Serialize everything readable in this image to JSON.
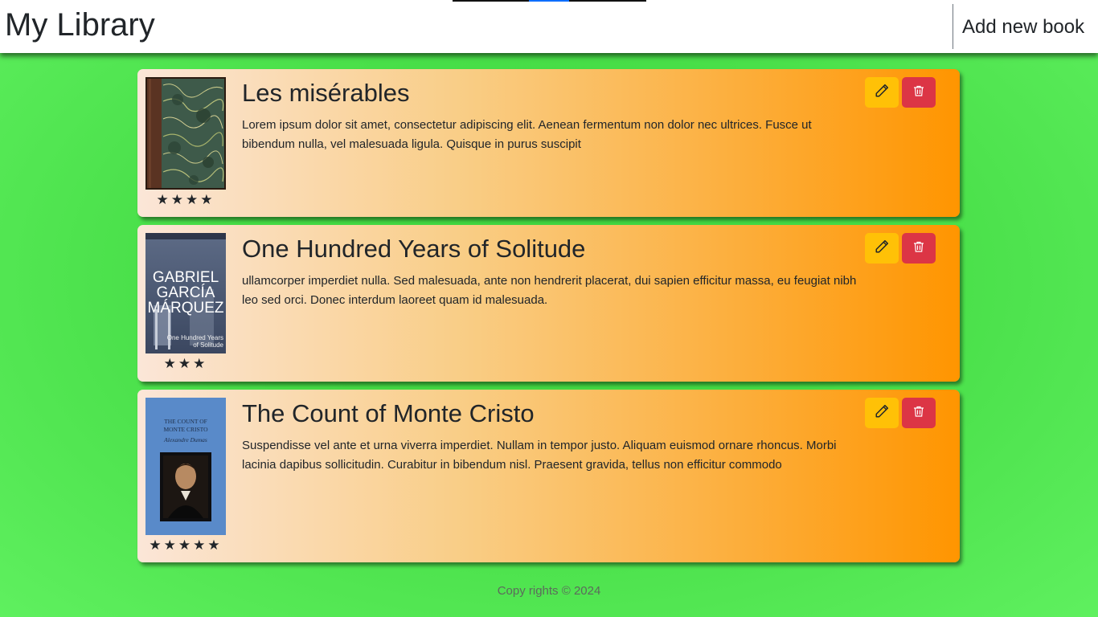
{
  "navbar": {
    "brand": "My Library",
    "add_label": "Add new book"
  },
  "books": [
    {
      "title": "Les misérables",
      "description": "Lorem ipsum dolor sit amet, consectetur adipiscing elit. Aenean fermentum non dolor nec ultrices. Fusce ut bibendum nulla, vel malesuada ligula. Quisque in purus suscipit",
      "rating": 4,
      "stars": "★★★★",
      "cover": "marbled-antique-book-cover"
    },
    {
      "title": "One Hundred Years of Solitude",
      "description": "ullamcorper imperdiet nulla. Sed malesuada, ante non hendrerit placerat, dui sapien efficitur massa, eu feugiat nibh leo sed orci. Donec interdum laoreet quam id malesuada.",
      "rating": 3,
      "stars": "★★★",
      "cover": {
        "author_line1": "GABRIEL",
        "author_line2": "GARCÍA",
        "author_line3": "MÁRQUEZ",
        "subtitle_line1": "One Hundred Years",
        "subtitle_line2": "of Solitude"
      }
    },
    {
      "title": "The Count of Monte Cristo",
      "description": "Suspendisse vel ante et urna viverra imperdiet. Nullam in tempor justo. Aliquam euismod ornare rhoncus. Morbi lacinia dapibus sollicitudin. Curabitur in bibendum nisl. Praesent gravida, tellus non efficitur commodo",
      "rating": 5,
      "stars": "★★★★★",
      "cover": {
        "title_line1": "THE COUNT OF",
        "title_line2": "MONTE CRISTO",
        "author": "Alexandre Dumas"
      }
    }
  ],
  "icons": {
    "edit": "pencil-icon",
    "delete": "trash-icon"
  },
  "colors": {
    "edit_button": "#ffc107",
    "delete_button": "#dc3545",
    "card_gradient_start": "#fbe6d8",
    "card_gradient_end": "#ff9500",
    "background": "#45dc45"
  },
  "footer": {
    "text": "Copy rights © 2024"
  }
}
